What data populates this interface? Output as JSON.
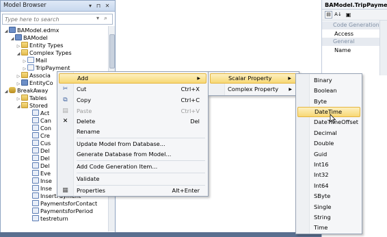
{
  "model_browser": {
    "title": "Model Browser",
    "search_placeholder": "Type here to search",
    "tree": [
      {
        "label": "BAModel.edmx"
      },
      {
        "label": "BAModel"
      },
      {
        "label": "Entity Types"
      },
      {
        "label": "Complex Types"
      },
      {
        "label": "Mail"
      },
      {
        "label": "TripPayment"
      },
      {
        "label": "Associa"
      },
      {
        "label": "EntityCo"
      },
      {
        "label": "BreakAway"
      },
      {
        "label": "Tables"
      },
      {
        "label": "Stored"
      },
      {
        "label": "Act"
      },
      {
        "label": "Can"
      },
      {
        "label": "Con"
      },
      {
        "label": "Cre"
      },
      {
        "label": "Cus"
      },
      {
        "label": "Del"
      },
      {
        "label": "Del"
      },
      {
        "label": "Del"
      },
      {
        "label": "Eve"
      },
      {
        "label": "Inse"
      },
      {
        "label": "Inse"
      },
      {
        "label": "InsertPayment"
      },
      {
        "label": "PaymentsforContact"
      },
      {
        "label": "PaymentsforPeriod"
      },
      {
        "label": "testreturn"
      }
    ]
  },
  "properties": {
    "title": "BAModel.TripPayment",
    "categories": [
      {
        "label": "Code Generation",
        "items": [
          "Access"
        ]
      },
      {
        "label": "General",
        "items": [
          "Name"
        ]
      }
    ]
  },
  "context_menu": {
    "items": [
      {
        "label": "Add",
        "shortcut": "",
        "icon": ""
      },
      {
        "label": "Cut",
        "shortcut": "Ctrl+X",
        "icon": "cut-icon"
      },
      {
        "label": "Copy",
        "shortcut": "Ctrl+C",
        "icon": "copy-icon"
      },
      {
        "label": "Paste",
        "shortcut": "Ctrl+V",
        "icon": "paste-icon"
      },
      {
        "label": "Delete",
        "shortcut": "Del",
        "icon": "delete-icon"
      },
      {
        "label": "Rename",
        "shortcut": "",
        "icon": ""
      },
      {
        "label": "Update Model from Database...",
        "shortcut": "",
        "icon": ""
      },
      {
        "label": "Generate Database from Model...",
        "shortcut": "",
        "icon": ""
      },
      {
        "label": "Add Code Generation Item...",
        "shortcut": "",
        "icon": ""
      },
      {
        "label": "Validate",
        "shortcut": "",
        "icon": ""
      },
      {
        "label": "Properties",
        "shortcut": "Alt+Enter",
        "icon": "properties-icon"
      }
    ]
  },
  "add_submenu": {
    "items": [
      "Scalar Property",
      "Complex Property"
    ]
  },
  "scalar_submenu": {
    "items": [
      "Binary",
      "Boolean",
      "Byte",
      "DateTime",
      "DateTimeOffset",
      "Decimal",
      "Double",
      "Guid",
      "Int16",
      "Int32",
      "Int64",
      "SByte",
      "Single",
      "String",
      "Time"
    ],
    "highlighted": "DateTime"
  },
  "colors": {
    "highlight": "#f7d774",
    "panel_border": "#8ea4c2"
  }
}
